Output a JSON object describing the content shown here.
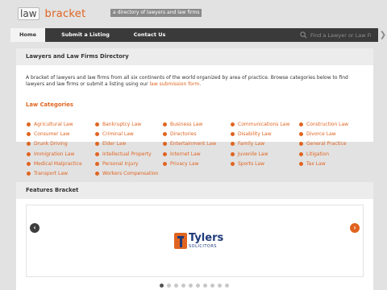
{
  "header": {
    "logo_box": "law",
    "logo_text": "bracket",
    "tagline": "a directory of lawyers and law firms"
  },
  "nav": {
    "items": [
      {
        "label": "Home",
        "active": true
      },
      {
        "label": "Submit a Listing",
        "active": false
      },
      {
        "label": "Contact Us",
        "active": false
      }
    ],
    "search_placeholder": "Find a Lawyer or Law Firm",
    "search_go_icon": "chevron-right-icon"
  },
  "directory": {
    "heading": "Lawyers and Law Firms Directory",
    "intro_text": "A bracket of lawyers and law firms from all six continents of the world organized by area of practice. Browse categories below to find lawyers and law firms or submit a listing using our",
    "intro_link": "law submission form",
    "intro_end": "."
  },
  "categories": {
    "title": "Law Categories",
    "columns": [
      [
        "Agricultural Law",
        "Consumer Law",
        "Drunk Driving",
        "Immigration Law",
        "Medical Malpractice",
        "Transport Law"
      ],
      [
        "Bankruptcy Law",
        "Criminal Law",
        "Elder Law",
        "Intellectual Property",
        "Personal Injury",
        "Workers Compensation"
      ],
      [
        "Business Law",
        "Directories",
        "Entertainment Law",
        "Internet Law",
        "Privacy Law"
      ],
      [
        "Communications Law",
        "Disability Law",
        "Family Law",
        "Juvenile Law",
        "Sports Law"
      ],
      [
        "Construction Law",
        "Divorce Law",
        "General Practice",
        "Litigation",
        "Tax Law"
      ]
    ]
  },
  "features": {
    "heading": "Features Bracket",
    "slide_logo": {
      "name": "Tylers",
      "sub": "SOLICITORS"
    },
    "pager_count": 10,
    "pager_active": 0
  },
  "colors": {
    "accent": "#e06420",
    "nav_bg": "#3a3a3a",
    "brand_blue": "#1e3a7a"
  }
}
